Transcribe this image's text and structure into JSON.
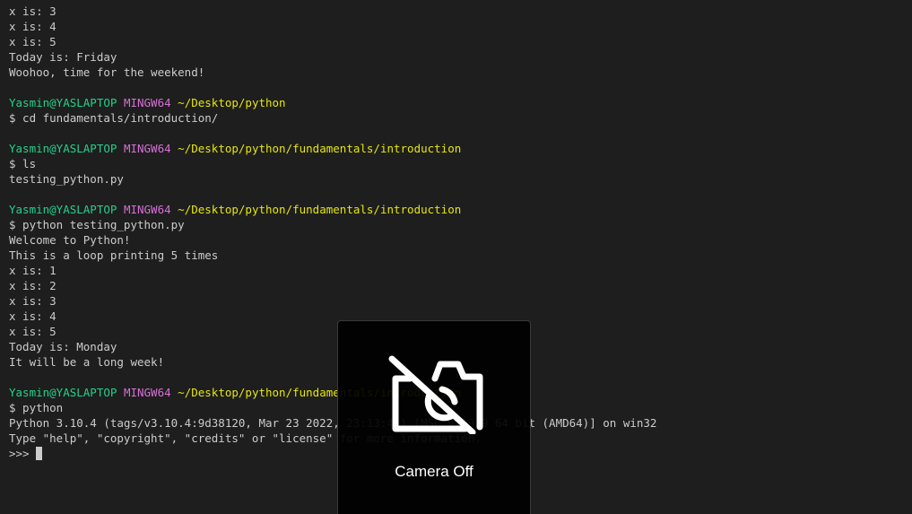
{
  "terminal": {
    "lines": [
      {
        "type": "out",
        "text": "x is: 3"
      },
      {
        "type": "out",
        "text": "x is: 4"
      },
      {
        "type": "out",
        "text": "x is: 5"
      },
      {
        "type": "out",
        "text": "Today is: Friday"
      },
      {
        "type": "out",
        "text": "Woohoo, time for the weekend!"
      },
      {
        "type": "blank"
      },
      {
        "type": "prompt",
        "user": "Yasmin@YASLAPTOP",
        "system": "MINGW64",
        "path": "~/Desktop/python"
      },
      {
        "type": "cmd",
        "text": "$ cd fundamentals/introduction/"
      },
      {
        "type": "blank"
      },
      {
        "type": "prompt",
        "user": "Yasmin@YASLAPTOP",
        "system": "MINGW64",
        "path": "~/Desktop/python/fundamentals/introduction"
      },
      {
        "type": "cmd",
        "text": "$ ls"
      },
      {
        "type": "out",
        "text": "testing_python.py"
      },
      {
        "type": "blank"
      },
      {
        "type": "prompt",
        "user": "Yasmin@YASLAPTOP",
        "system": "MINGW64",
        "path": "~/Desktop/python/fundamentals/introduction"
      },
      {
        "type": "cmd",
        "text": "$ python testing_python.py"
      },
      {
        "type": "out",
        "text": "Welcome to Python!"
      },
      {
        "type": "out",
        "text": "This is a loop printing 5 times"
      },
      {
        "type": "out",
        "text": "x is: 1"
      },
      {
        "type": "out",
        "text": "x is: 2"
      },
      {
        "type": "out",
        "text": "x is: 3"
      },
      {
        "type": "out",
        "text": "x is: 4"
      },
      {
        "type": "out",
        "text": "x is: 5"
      },
      {
        "type": "out",
        "text": "Today is: Monday"
      },
      {
        "type": "out",
        "text": "It will be a long week!"
      },
      {
        "type": "blank"
      },
      {
        "type": "prompt",
        "user": "Yasmin@YASLAPTOP",
        "system": "MINGW64",
        "path": "~/Desktop/python/fundamentals/introduction"
      },
      {
        "type": "cmd",
        "text": "$ python"
      },
      {
        "type": "out",
        "text": "Python 3.10.4 (tags/v3.10.4:9d38120, Mar 23 2022, 23:13:41) [MSC v.1929 64 bit (AMD64)] on win32"
      },
      {
        "type": "out",
        "text": "Type \"help\", \"copyright\", \"credits\" or \"license\" for more information."
      },
      {
        "type": "input",
        "text": ">>> "
      }
    ]
  },
  "camera": {
    "label": "Camera Off",
    "icon": "camera-off-icon"
  },
  "colors": {
    "background": "#1e1e1e",
    "text": "#cccccc",
    "user": "#23d18b",
    "system": "#d670d6",
    "path": "#e5e510"
  }
}
